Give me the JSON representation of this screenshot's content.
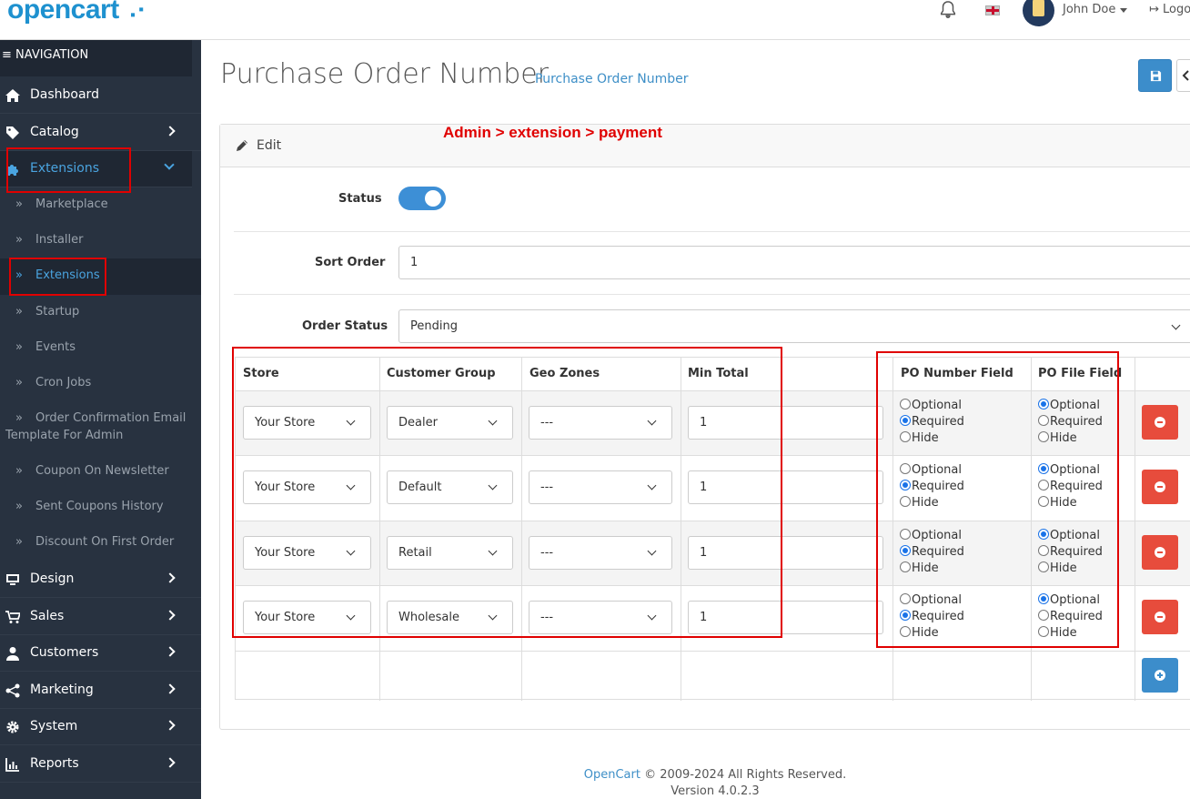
{
  "header": {
    "logo": "opencart",
    "user_name": "John Doe",
    "logout_label": "Logout"
  },
  "sidebar": {
    "nav_title": "NAVIGATION",
    "items": [
      {
        "label": "Dashboard",
        "icon": "home-icon"
      },
      {
        "label": "Catalog",
        "icon": "tag-icon"
      },
      {
        "label": "Extensions",
        "icon": "puzzle-icon"
      },
      {
        "label": "Design",
        "icon": "monitor-icon"
      },
      {
        "label": "Sales",
        "icon": "cart-icon"
      },
      {
        "label": "Customers",
        "icon": "user-icon"
      },
      {
        "label": "Marketing",
        "icon": "share-icon"
      },
      {
        "label": "System",
        "icon": "gear-icon"
      },
      {
        "label": "Reports",
        "icon": "chart-icon"
      }
    ],
    "sub_items": [
      "Marketplace",
      "Installer",
      "Extensions",
      "Startup",
      "Events",
      "Cron Jobs",
      "Order Confirmation Email",
      "Template For Admin",
      "Coupon On Newsletter",
      "Sent Coupons History",
      "Discount On First Order"
    ]
  },
  "page": {
    "title": "Purchase Order Number",
    "breadcrumb": "Purchase Order Number",
    "card_title": "Edit",
    "annotation": "Admin > extension > payment"
  },
  "form": {
    "status_label": "Status",
    "sort_order_label": "Sort Order",
    "sort_order_value": "1",
    "order_status_label": "Order Status",
    "order_status_value": "Pending"
  },
  "table": {
    "headers": [
      "Store",
      "Customer Group",
      "Geo Zones",
      "Min Total",
      "PO Number Field",
      "PO File Field"
    ],
    "radio_options": [
      "Optional",
      "Required",
      "Hide"
    ],
    "rows": [
      {
        "store": "Your Store",
        "group": "Dealer",
        "geo": "---",
        "min": "1"
      },
      {
        "store": "Your Store",
        "group": "Default",
        "geo": "---",
        "min": "1"
      },
      {
        "store": "Your Store",
        "group": "Retail",
        "geo": "---",
        "min": "1"
      },
      {
        "store": "Your Store",
        "group": "Wholesale",
        "geo": "---",
        "min": "1"
      }
    ]
  },
  "footer": {
    "brand": "OpenCart",
    "copyright": "© 2009-2024 All Rights Reserved.",
    "version": "Version 4.0.2.3"
  },
  "colors": {
    "primary": "#3c8dcb",
    "danger": "#e74c3c",
    "sidebar": "#283240",
    "annotation": "#e00000"
  }
}
